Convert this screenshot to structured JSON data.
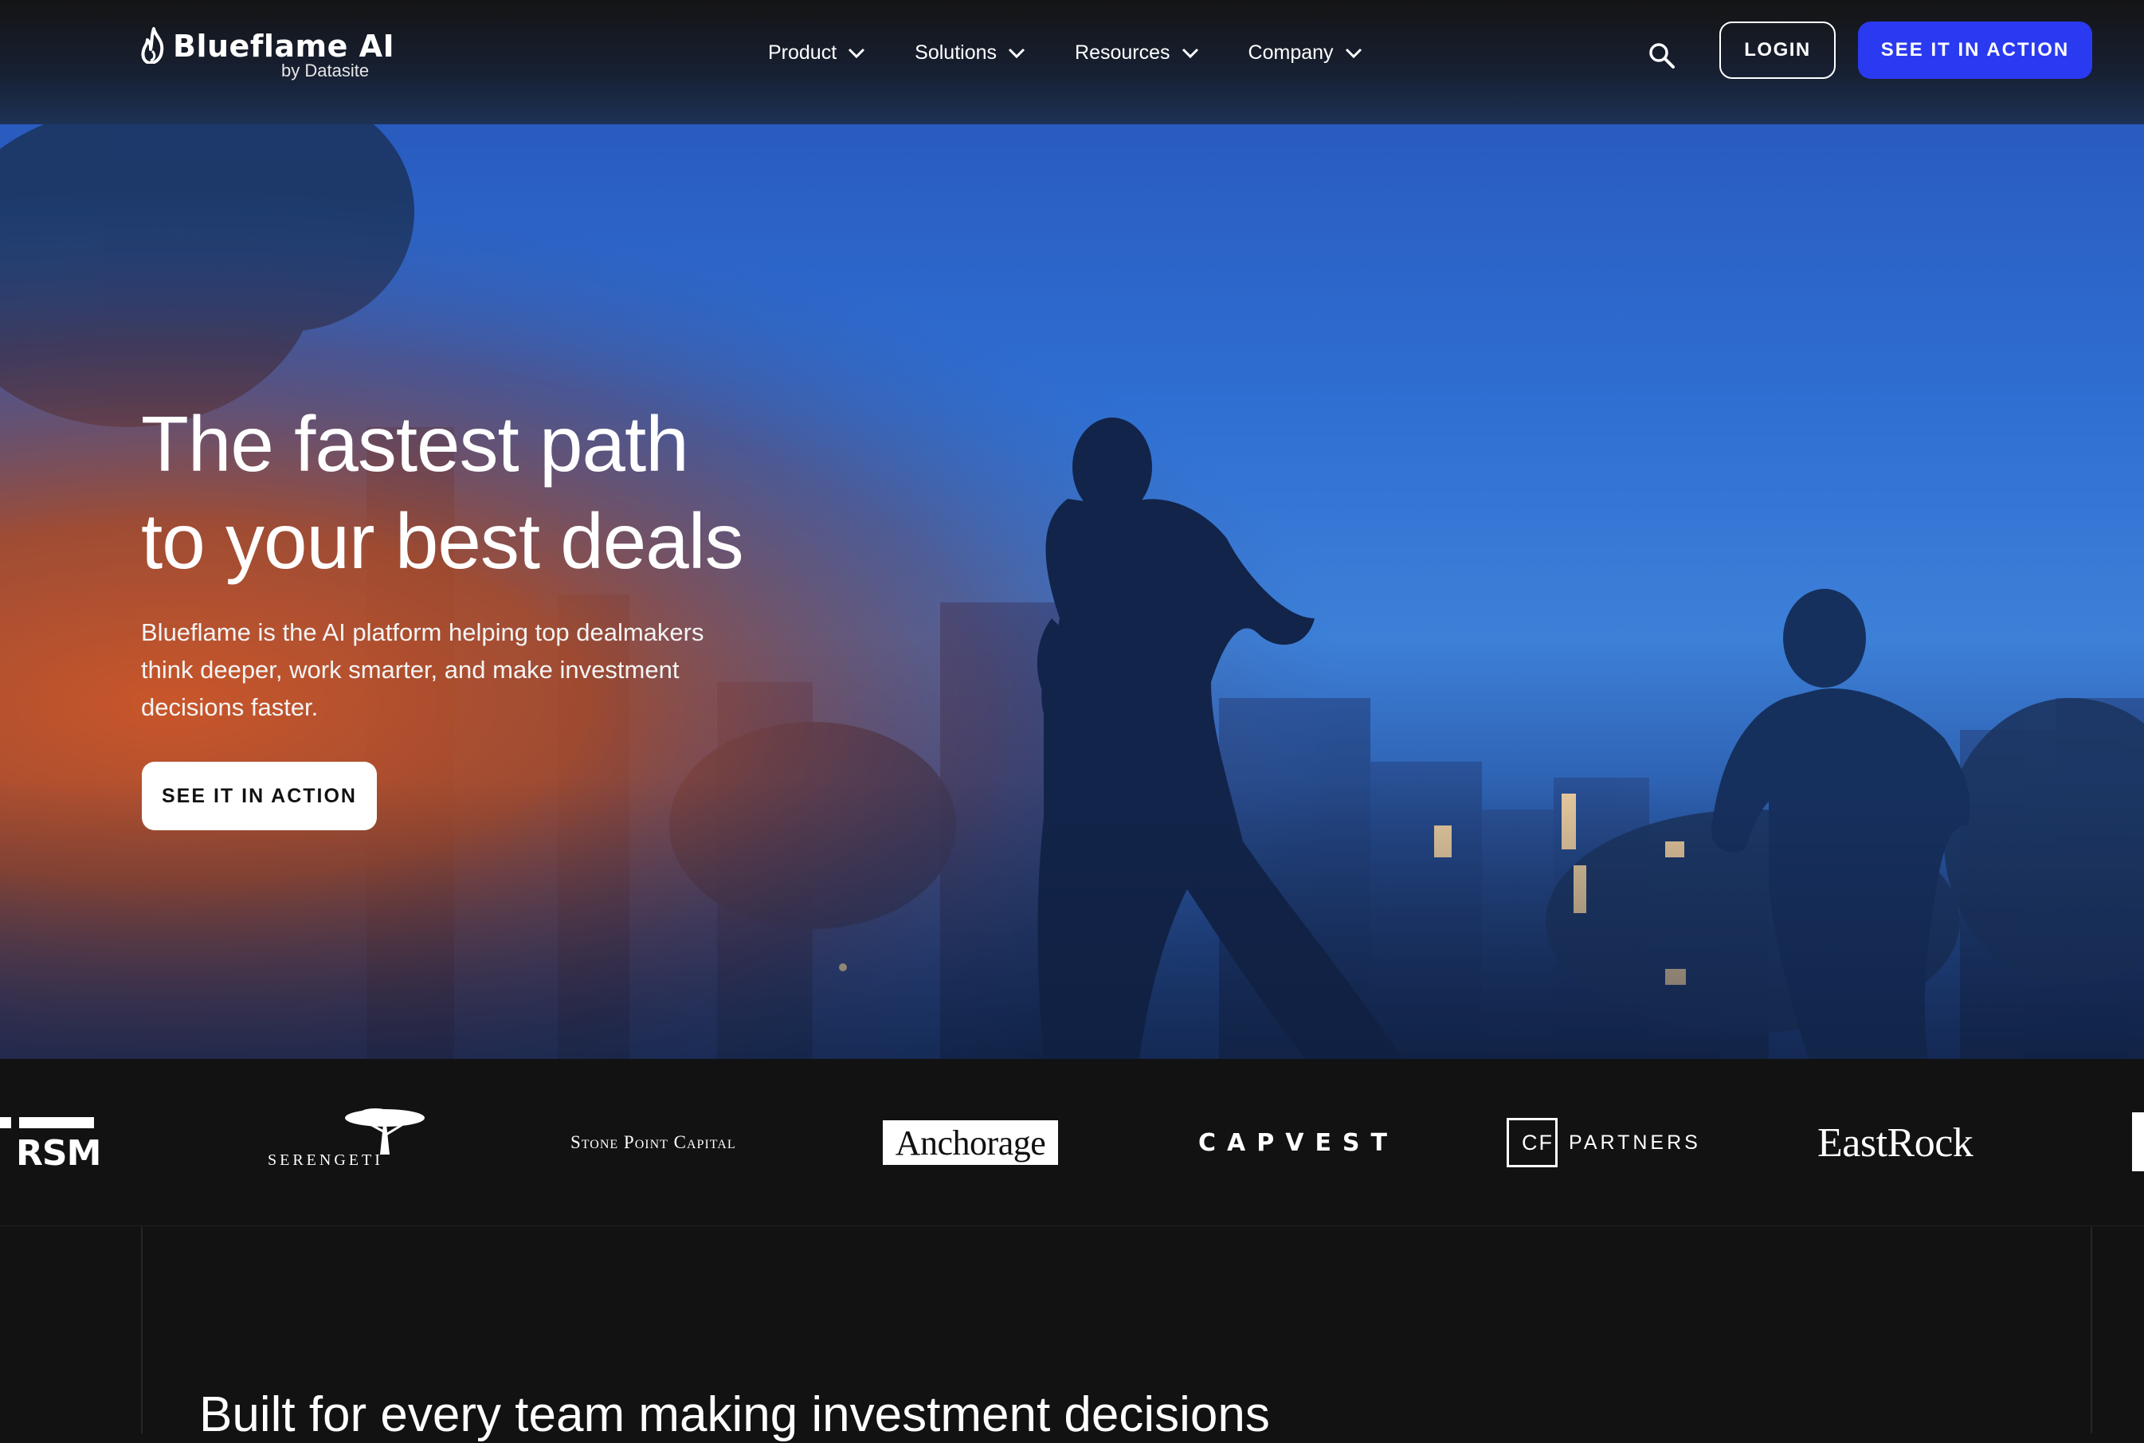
{
  "brand": {
    "name": "Blueflame AI",
    "sub": "by Datasite"
  },
  "nav": {
    "items": [
      {
        "label": "Product"
      },
      {
        "label": "Solutions"
      },
      {
        "label": "Resources"
      },
      {
        "label": "Company"
      }
    ],
    "login_label": "LOGIN",
    "cta_label": "SEE IT IN ACTION"
  },
  "hero": {
    "title_line1": "The fastest path",
    "title_line2": "to your best deals",
    "description": "Blueflame is the AI platform helping top dealmakers think deeper, work smarter, and make investment decisions faster.",
    "cta_label": "SEE IT IN ACTION"
  },
  "clients": [
    {
      "name": "RSM"
    },
    {
      "name": "SERENGETI"
    },
    {
      "name": "Stone Point Capital"
    },
    {
      "name": "Anchorage"
    },
    {
      "name": "CAPVEST"
    },
    {
      "name": "CFI",
      "word": "PARTNERS"
    },
    {
      "name": "EastRock"
    }
  ],
  "section": {
    "title": "Built for every team making investment decisions"
  },
  "colors": {
    "accent": "#2a3af0",
    "background": "#121212"
  },
  "icons": {
    "search": "search-icon",
    "chevron": "chevron-down-icon",
    "flame": "flame-logo-icon"
  }
}
